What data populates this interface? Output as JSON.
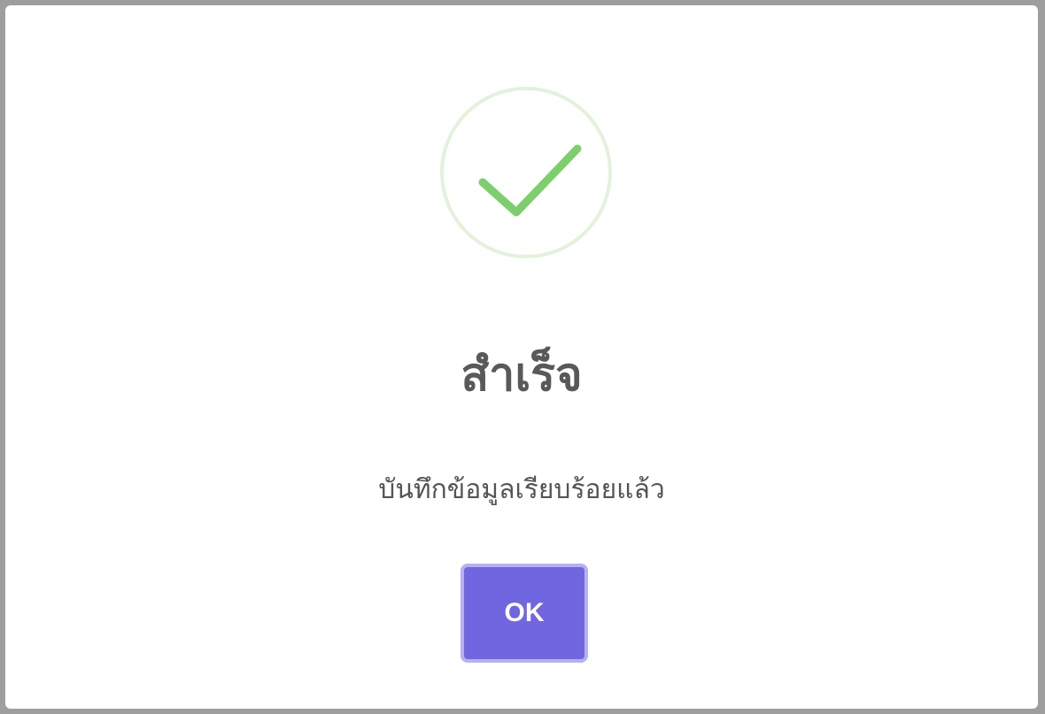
{
  "dialog": {
    "icon": "success-check-icon",
    "title": "สำเร็จ",
    "message": "บันทึกข้อมูลเรียบร้อยแล้ว",
    "confirm_label": "OK"
  },
  "colors": {
    "success_ring": "#e2f2db",
    "success_check": "#7dcf6b",
    "confirm_button": "#7066e0",
    "confirm_button_focus": "#b6b0f2",
    "title_text": "#595959",
    "message_text": "#545454"
  }
}
